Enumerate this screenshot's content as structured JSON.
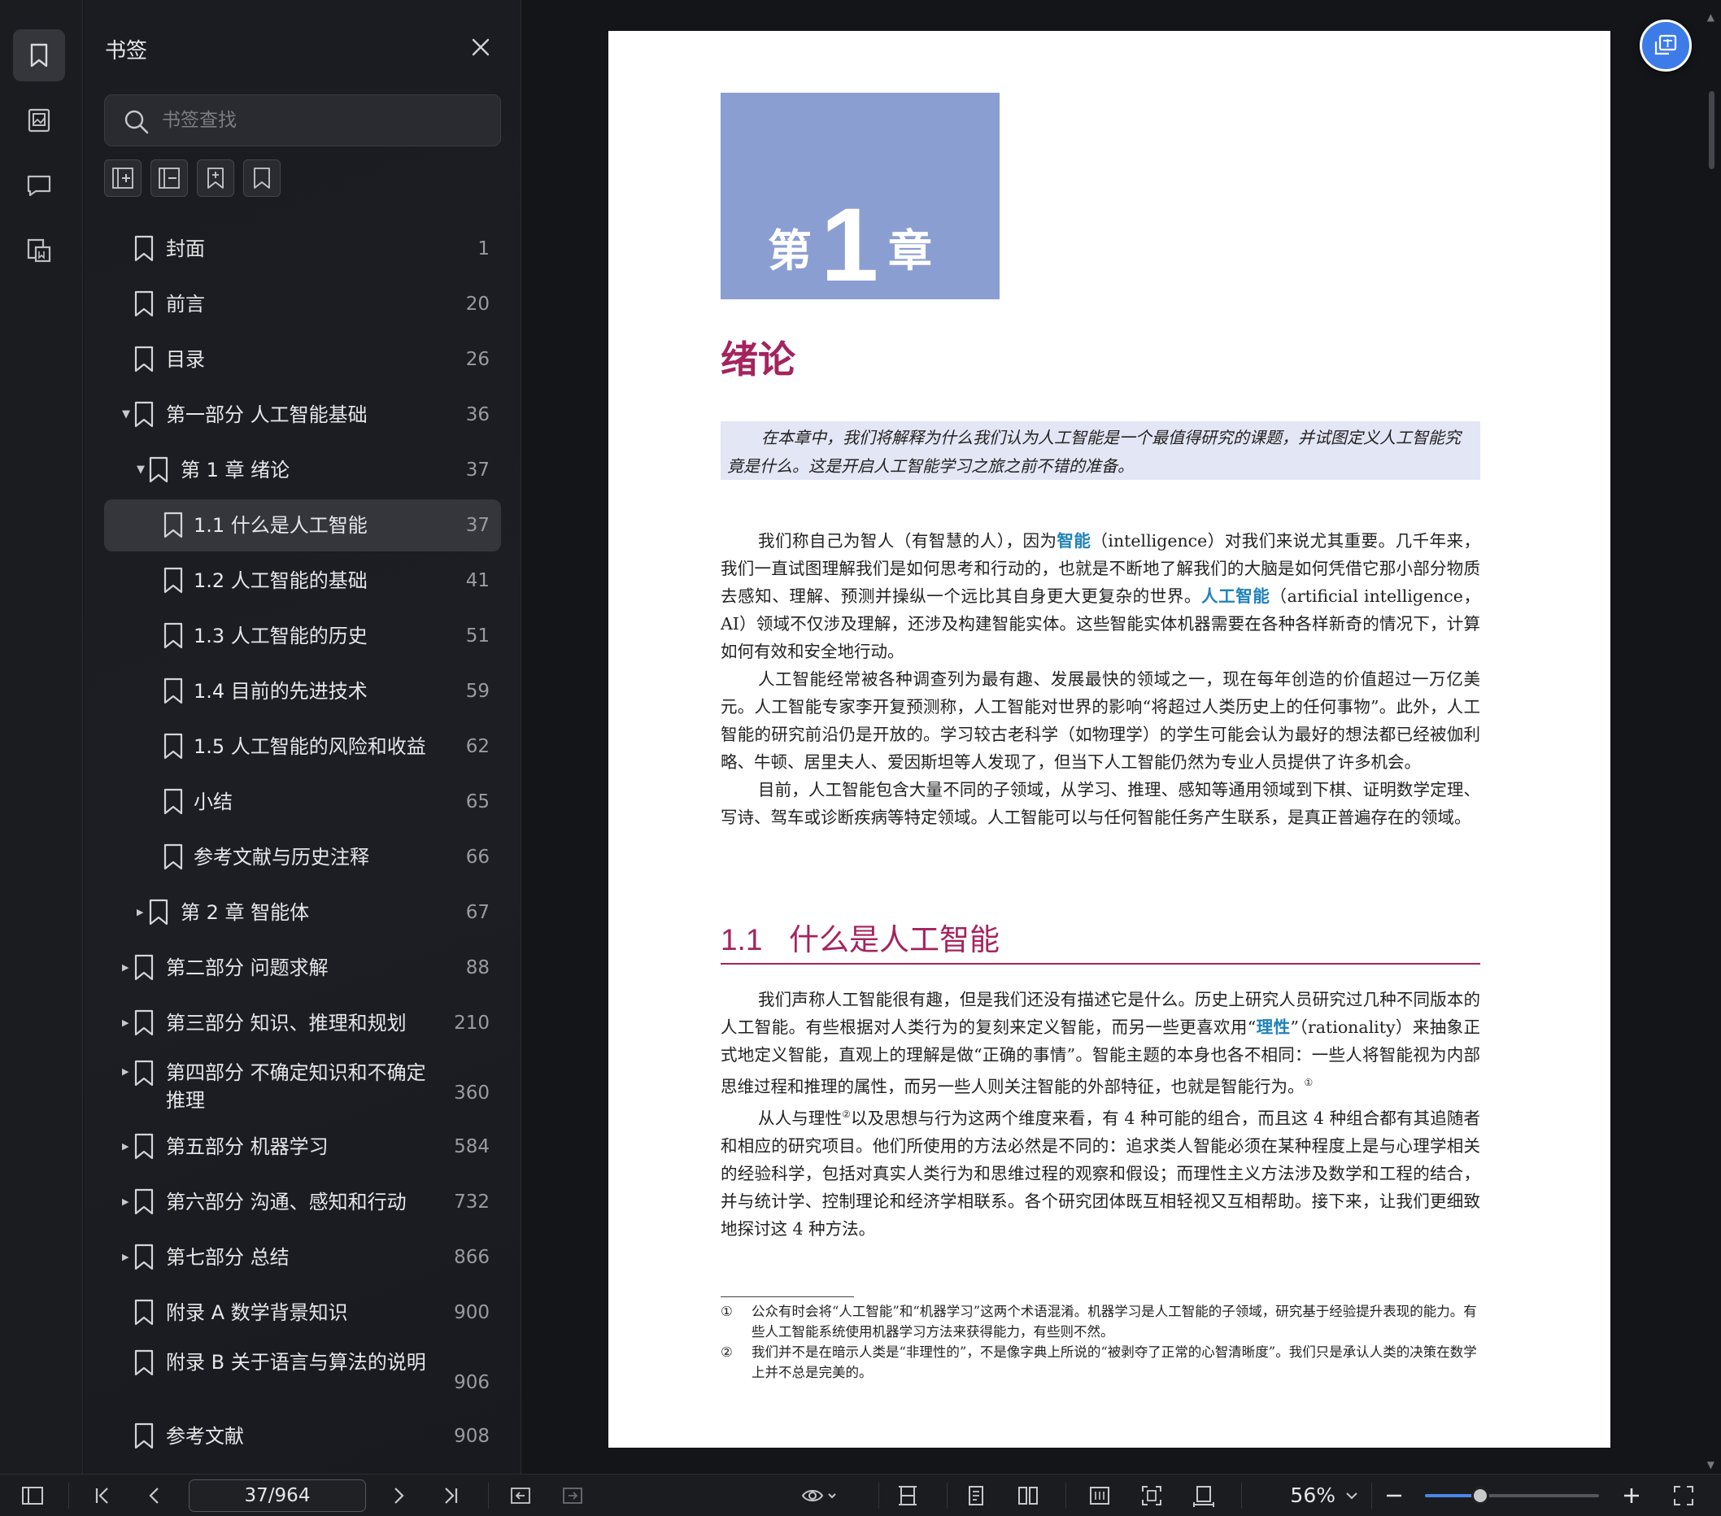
{
  "sidebar_rail": {
    "items": [
      {
        "name": "bookmark-panel-icon",
        "active": true
      },
      {
        "name": "thumbnail-panel-icon",
        "active": false
      },
      {
        "name": "comment-panel-icon",
        "active": false
      },
      {
        "name": "extract-panel-icon",
        "active": false
      }
    ]
  },
  "bookmark_panel": {
    "title": "书签",
    "search_placeholder": "书签查找",
    "tools": [
      "expand-all-icon",
      "collapse-all-icon",
      "add-bookmark-icon",
      "bookmark-icon"
    ],
    "items": [
      {
        "label": "封面",
        "page": "1",
        "level": 0,
        "toggle": "none",
        "selected": false
      },
      {
        "label": "前言",
        "page": "20",
        "level": 0,
        "toggle": "none",
        "selected": false
      },
      {
        "label": "目录",
        "page": "26",
        "level": 0,
        "toggle": "none",
        "selected": false
      },
      {
        "label": "第一部分 人工智能基础",
        "page": "36",
        "level": 0,
        "toggle": "expanded",
        "selected": false
      },
      {
        "label": "第 1 章 绪论",
        "page": "37",
        "level": 1,
        "toggle": "expanded",
        "selected": false
      },
      {
        "label": "1.1 什么是人工智能",
        "page": "37",
        "level": 2,
        "toggle": "none",
        "selected": true
      },
      {
        "label": "1.2 人工智能的基础",
        "page": "41",
        "level": 2,
        "toggle": "none",
        "selected": false
      },
      {
        "label": "1.3 人工智能的历史",
        "page": "51",
        "level": 2,
        "toggle": "none",
        "selected": false
      },
      {
        "label": "1.4 目前的先进技术",
        "page": "59",
        "level": 2,
        "toggle": "none",
        "selected": false
      },
      {
        "label": "1.5 人工智能的风险和收益",
        "page": "62",
        "level": 2,
        "toggle": "none",
        "selected": false
      },
      {
        "label": "小结",
        "page": "65",
        "level": 2,
        "toggle": "none",
        "selected": false
      },
      {
        "label": "参考文献与历史注释",
        "page": "66",
        "level": 2,
        "toggle": "none",
        "selected": false
      },
      {
        "label": "第 2 章 智能体",
        "page": "67",
        "level": 1,
        "toggle": "collapsed",
        "selected": false
      },
      {
        "label": "第二部分 问题求解",
        "page": "88",
        "level": 0,
        "toggle": "collapsed",
        "selected": false
      },
      {
        "label": "第三部分 知识、推理和规划",
        "page": "210",
        "level": 0,
        "toggle": "collapsed",
        "selected": false
      },
      {
        "label": "第四部分 不确定知识和不确定推理",
        "page": "360",
        "level": 0,
        "toggle": "collapsed",
        "selected": false
      },
      {
        "label": "第五部分 机器学习",
        "page": "584",
        "level": 0,
        "toggle": "collapsed",
        "selected": false
      },
      {
        "label": "第六部分 沟通、感知和行动",
        "page": "732",
        "level": 0,
        "toggle": "collapsed",
        "selected": false
      },
      {
        "label": "第七部分 总结",
        "page": "866",
        "level": 0,
        "toggle": "collapsed",
        "selected": false
      },
      {
        "label": "附录 A 数学背景知识",
        "page": "900",
        "level": 0,
        "toggle": "none",
        "selected": false
      },
      {
        "label": "附录 B 关于语言与算法的说明",
        "page": "906",
        "level": 0,
        "toggle": "none",
        "selected": false
      },
      {
        "label": "参考文献",
        "page": "908",
        "level": 0,
        "toggle": "none",
        "selected": false
      }
    ]
  },
  "document": {
    "chapter_label_pre": "第",
    "chapter_number": "1",
    "chapter_label_post": "章",
    "chapter_title": "绪论",
    "abstract": "在本章中，我们将解释为什么我们认为人工智能是一个最值得研究的课题，并试图定义人工智能究竟是什么。这是开启人工智能学习之旅之前不错的准备。",
    "p1_a": "我们称自己为智人（有智慧的人），因为",
    "p1_kw1": "智能",
    "p1_b": "（intelligence）对我们来说尤其重要。几千年来，我们一直试图理解我们是如何思考和行动的，也就是不断地了解我们的大脑是如何凭借它那小部分物质去感知、理解、预测并操纵一个远比其自身更大更复杂的世界。",
    "p1_kw2": "人工智能",
    "p1_c": "（artificial intelligence，AI）领域不仅涉及理解，还涉及构建智能实体。这些智能实体机器需要在各种各样新奇的情况下，计算如何有效和安全地行动。",
    "p2": "人工智能经常被各种调查列为最有趣、发展最快的领域之一，现在每年创造的价值超过一万亿美元。人工智能专家李开复预测称，人工智能对世界的影响“将超过人类历史上的任何事物”。此外，人工智能的研究前沿仍是开放的。学习较古老科学（如物理学）的学生可能会认为最好的想法都已经被伽利略、牛顿、居里夫人、爱因斯坦等人发现了，但当下人工智能仍然为专业人员提供了许多机会。",
    "p3": "目前，人工智能包含大量不同的子领域，从学习、推理、感知等通用领域到下棋、证明数学定理、写诗、驾车或诊断疾病等特定领域。人工智能可以与任何智能任务产生联系，是真正普遍存在的领域。",
    "section_number": "1.1",
    "section_title": "什么是人工智能",
    "p4_a": "我们声称人工智能很有趣，但是我们还没有描述它是什么。历史上研究人员研究过几种不同版本的人工智能。有些根据对人类行为的复刻来定义智能，而另一些更喜欢用“",
    "p4_kw": "理性",
    "p4_b": "”（rationality）来抽象正式地定义智能，直观上的理解是做“正确的事情”。智能主题的本身也各不相同：一些人将智能视为内部思维过程和推理的属性，而另一些人则关注智能的外部特征，也就是智能行为。",
    "p4_sup": "①",
    "p5_a": "从人与理性",
    "p5_sup": "②",
    "p5_b": "以及思想与行为这两个维度来看，有 4 种可能的组合，而且这 4 种组合都有其追随者和相应的研究项目。他们所使用的方法必然是不同的：追求类人智能必须在某种程度上是与心理学相关的经验科学，包括对真实人类行为和思维过程的观察和假设；而理性主义方法涉及数学和工程的结合，并与统计学、控制理论和经济学相联系。各个研究团体既互相轻视又互相帮助。接下来，让我们更细致地探讨这 4 种方法。",
    "footnotes": [
      {
        "mark": "①",
        "text": "公众有时会将“人工智能”和“机器学习”这两个术语混淆。机器学习是人工智能的子领域，研究基于经验提升表现的能力。有些人工智能系统使用机器学习方法来获得能力，有些则不然。"
      },
      {
        "mark": "②",
        "text": "我们并不是在暗示人类是“非理性的”，不是像字典上所说的“被剥夺了正常的心智清晰度”。我们只是承认人类的决策在数学上并不总是完美的。"
      }
    ]
  },
  "toolbar": {
    "page_indicator": "37/964",
    "zoom": "56%",
    "zoom_fraction": 0.32,
    "accent_color": "#4a86e8"
  }
}
